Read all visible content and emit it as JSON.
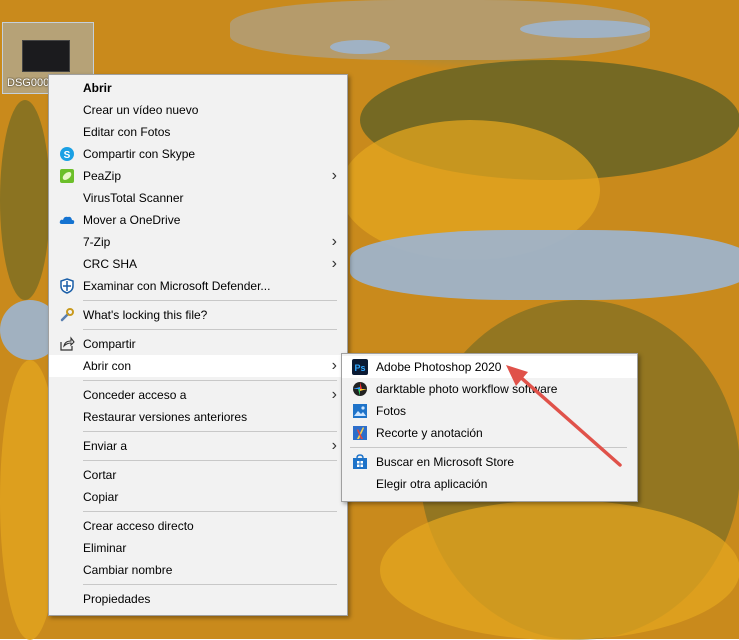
{
  "desktop": {
    "file_label": "DSG0005"
  },
  "context_menu": {
    "items": [
      {
        "label": "Abrir"
      },
      {
        "label": "Crear un vídeo nuevo"
      },
      {
        "label": "Editar con Fotos"
      },
      {
        "label": "Compartir con Skype",
        "icon": "skype-icon"
      },
      {
        "label": "PeaZip",
        "icon": "peazip-icon"
      },
      {
        "label": "VirusTotal Scanner"
      },
      {
        "label": "Mover a OneDrive",
        "icon": "onedrive-icon"
      },
      {
        "label": "7-Zip"
      },
      {
        "label": "CRC SHA"
      },
      {
        "label": "Examinar con Microsoft Defender...",
        "icon": "defender-icon"
      },
      {
        "label": "What's locking this file?",
        "icon": "wrench-icon"
      },
      {
        "label": "Compartir",
        "icon": "share-icon"
      },
      {
        "label": "Abrir con"
      },
      {
        "label": "Conceder acceso a"
      },
      {
        "label": "Restaurar versiones anteriores"
      },
      {
        "label": "Enviar a"
      },
      {
        "label": "Cortar"
      },
      {
        "label": "Copiar"
      },
      {
        "label": "Crear acceso directo"
      },
      {
        "label": "Eliminar"
      },
      {
        "label": "Cambiar nombre"
      },
      {
        "label": "Propiedades"
      }
    ]
  },
  "submenu": {
    "items": [
      {
        "label": "Adobe Photoshop 2020",
        "icon": "photoshop-icon",
        "icon_text": "Ps"
      },
      {
        "label": "darktable photo workflow software",
        "icon": "darktable-icon"
      },
      {
        "label": "Fotos",
        "icon": "photos-icon"
      },
      {
        "label": "Recorte y anotación",
        "icon": "snip-sketch-icon"
      },
      {
        "label": "Buscar en Microsoft Store",
        "icon": "store-icon"
      },
      {
        "label": "Elegir otra aplicación"
      }
    ]
  },
  "colors": {
    "annotation_arrow": "#e0524a",
    "menu_bg": "#f2f2f2",
    "highlight": "#ffffff"
  }
}
